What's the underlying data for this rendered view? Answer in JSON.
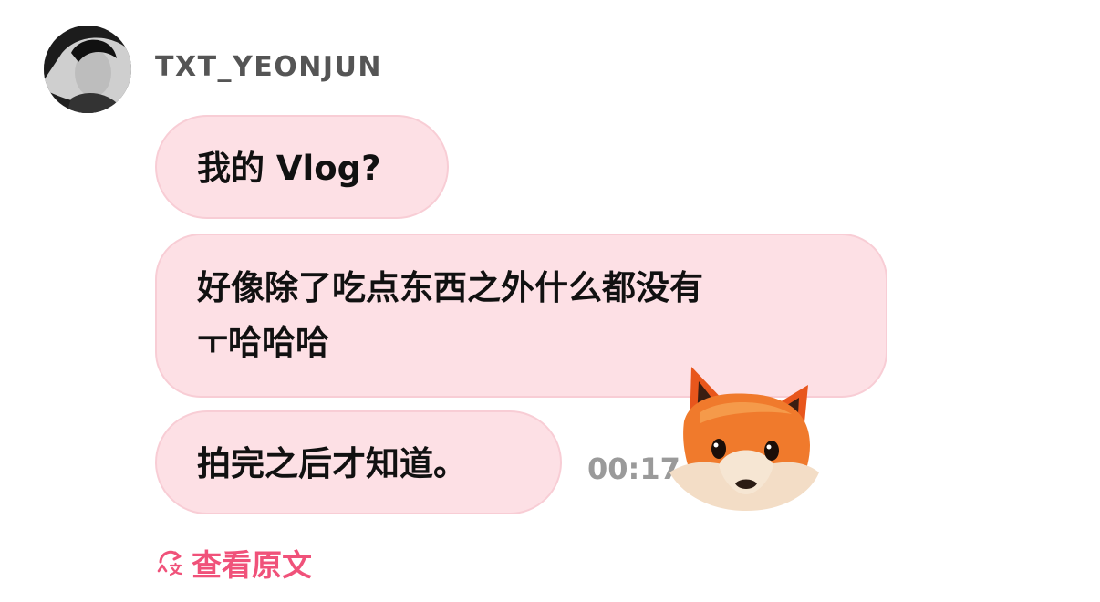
{
  "header": {
    "sender_name": "TXT_YEONJUN",
    "avatar_icon": "profile-photo"
  },
  "messages": [
    {
      "text": "我的 Vlog?"
    },
    {
      "text": "好像除了吃点东西之外什么都没有\nㅜ哈哈哈"
    },
    {
      "text": "拍完之后才知道。"
    }
  ],
  "timestamp": "00:17",
  "sticker": {
    "icon": "fox-emoji-sticker"
  },
  "translate": {
    "icon": "translate-icon",
    "label": "查看原文"
  },
  "colors": {
    "bubble": "#fde0e5",
    "accent": "#f0527a",
    "timestamp": "#9a9a9a"
  }
}
